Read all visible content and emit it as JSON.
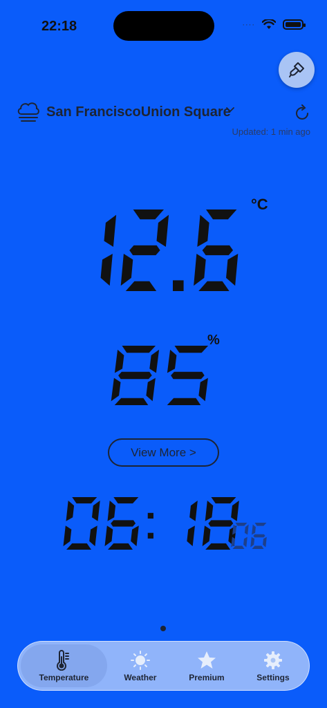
{
  "status": {
    "time": "22:18",
    "signal": "····"
  },
  "location": {
    "name": "San FranciscoUnion Square",
    "updated": "Updated: 1 min ago"
  },
  "temperature": {
    "value": "12.6",
    "unit": "°C"
  },
  "humidity": {
    "value": "85",
    "unit": "%"
  },
  "clock": {
    "hm": "06:18",
    "seconds": "06"
  },
  "view_more_label": "View More >",
  "tabs": [
    {
      "label": "Temperature",
      "icon": "thermometer-icon",
      "active": true
    },
    {
      "label": "Weather",
      "icon": "sun-icon",
      "active": false
    },
    {
      "label": "Premium",
      "icon": "star-icon",
      "active": false
    },
    {
      "label": "Settings",
      "icon": "gear-icon",
      "active": false
    }
  ],
  "colors": {
    "background": "#0A5CFA",
    "digit": "#111111",
    "seconds_digit": "#1D3F8A",
    "accent": "#A9C4F5"
  }
}
